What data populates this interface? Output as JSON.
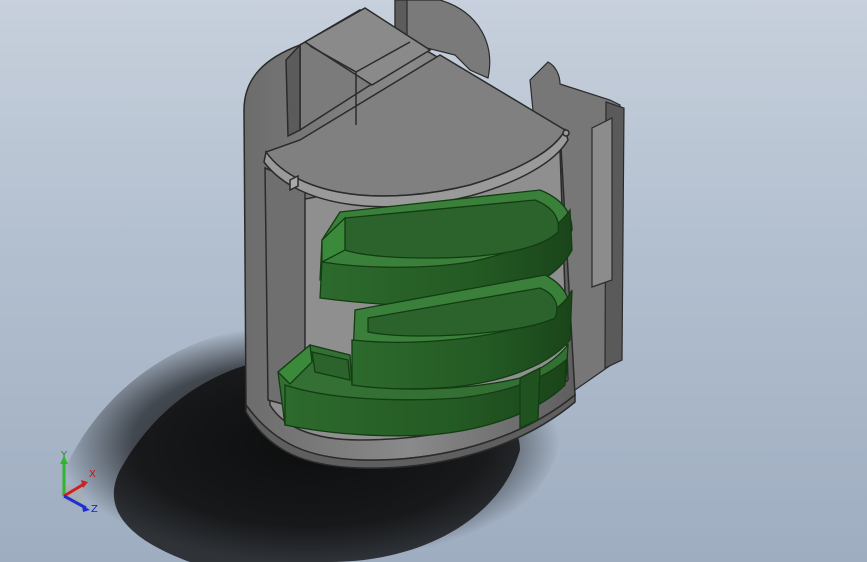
{
  "viewport": {
    "background_top": "#c7d0dc",
    "background_bottom": "#9eadc0"
  },
  "model": {
    "cabinet_color": "#7d7d7d",
    "cabinet_edge_color": "#2b2b2b",
    "tray_color": "#2f6b2f",
    "tray_edge_color": "#123d12"
  },
  "triad": {
    "y_label": "Y",
    "x_label": "X",
    "z_label": "Z",
    "y_color": "#2fb52f",
    "x_color": "#d02020",
    "z_color": "#2030d0"
  }
}
